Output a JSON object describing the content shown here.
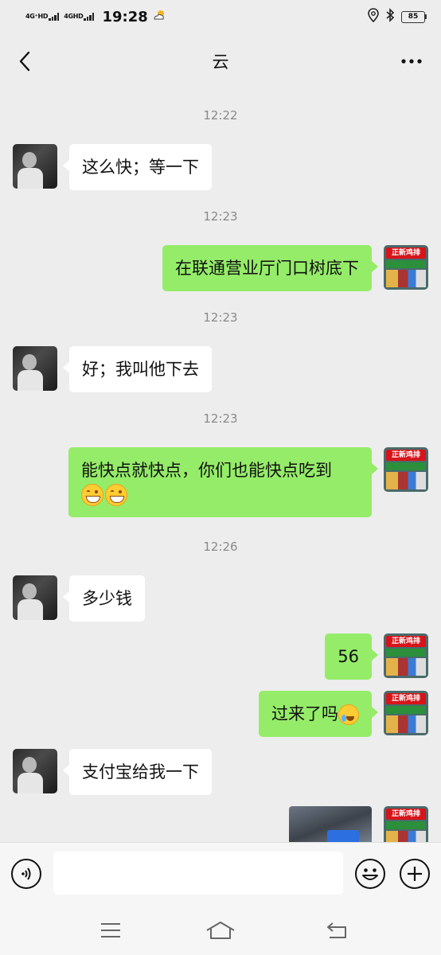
{
  "status_bar": {
    "network1": "4G⁺HD",
    "network2": "4GHD",
    "time": "19:28",
    "battery": "85"
  },
  "nav": {
    "title": "云"
  },
  "messages": [
    {
      "type": "time",
      "text": "12:22"
    },
    {
      "type": "text",
      "side": "left",
      "text": "这么快；等一下"
    },
    {
      "type": "time",
      "text": "12:23"
    },
    {
      "type": "text",
      "side": "right",
      "text": "在联通营业厅门口树底下"
    },
    {
      "type": "time",
      "text": "12:23"
    },
    {
      "type": "text",
      "side": "left",
      "text": "好；我叫他下去"
    },
    {
      "type": "time",
      "text": "12:23"
    },
    {
      "type": "text",
      "side": "right",
      "text": "能快点就快点，你们也能快点吃到"
    },
    {
      "type": "time",
      "text": "12:26"
    },
    {
      "type": "text",
      "side": "left",
      "text": "多少钱"
    },
    {
      "type": "text",
      "side": "right",
      "text": "56"
    },
    {
      "type": "text",
      "side": "right",
      "text": "过来了吗"
    },
    {
      "type": "text",
      "side": "left",
      "text": "支付宝给我一下"
    },
    {
      "type": "image",
      "side": "right"
    }
  ],
  "avatar_right_sign": "正新鸡排",
  "input": {
    "value": ""
  },
  "colors": {
    "sent_bubble": "#95ec69",
    "received_bubble": "#ffffff",
    "background": "#ededed"
  }
}
